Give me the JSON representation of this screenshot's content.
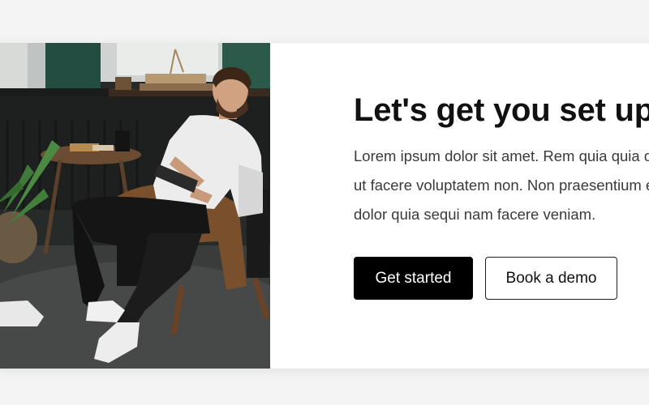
{
  "hero": {
    "title": "Let's get you set up",
    "body": "Lorem ipsum dolor sit amet. Rem quia quia dolorem ut facere voluptatem non. Non praesentium error qui dolor quia sequi nam facere veniam.",
    "primary_button": "Get started",
    "secondary_button": "Book a demo",
    "image": "man-seated-with-tablet-photo"
  },
  "colors": {
    "page_background": "#f4f4f5",
    "card_background": "#ffffff",
    "primary_button_bg": "#000000",
    "primary_button_text": "#ffffff",
    "secondary_button_border": "#1f1f1f"
  }
}
